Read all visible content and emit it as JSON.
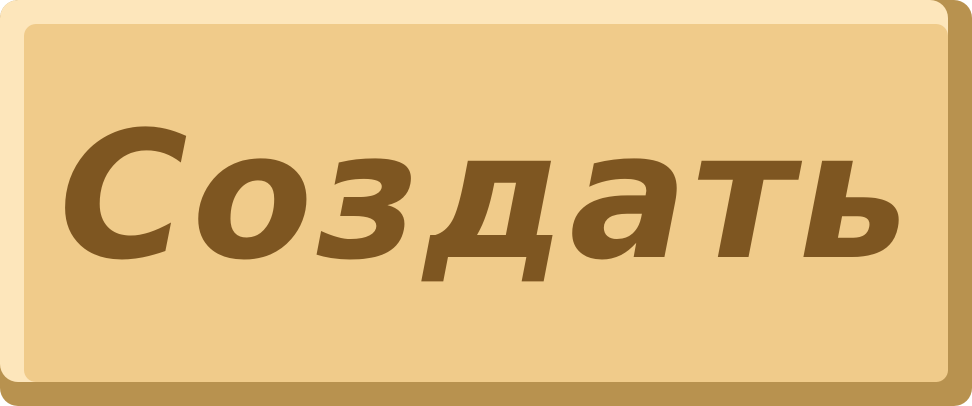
{
  "button": {
    "label": "Создать",
    "colors": {
      "face": "#f0cb8a",
      "highlight": "#fde6bb",
      "shadow": "#b8924f",
      "text": "#7e5621"
    }
  }
}
